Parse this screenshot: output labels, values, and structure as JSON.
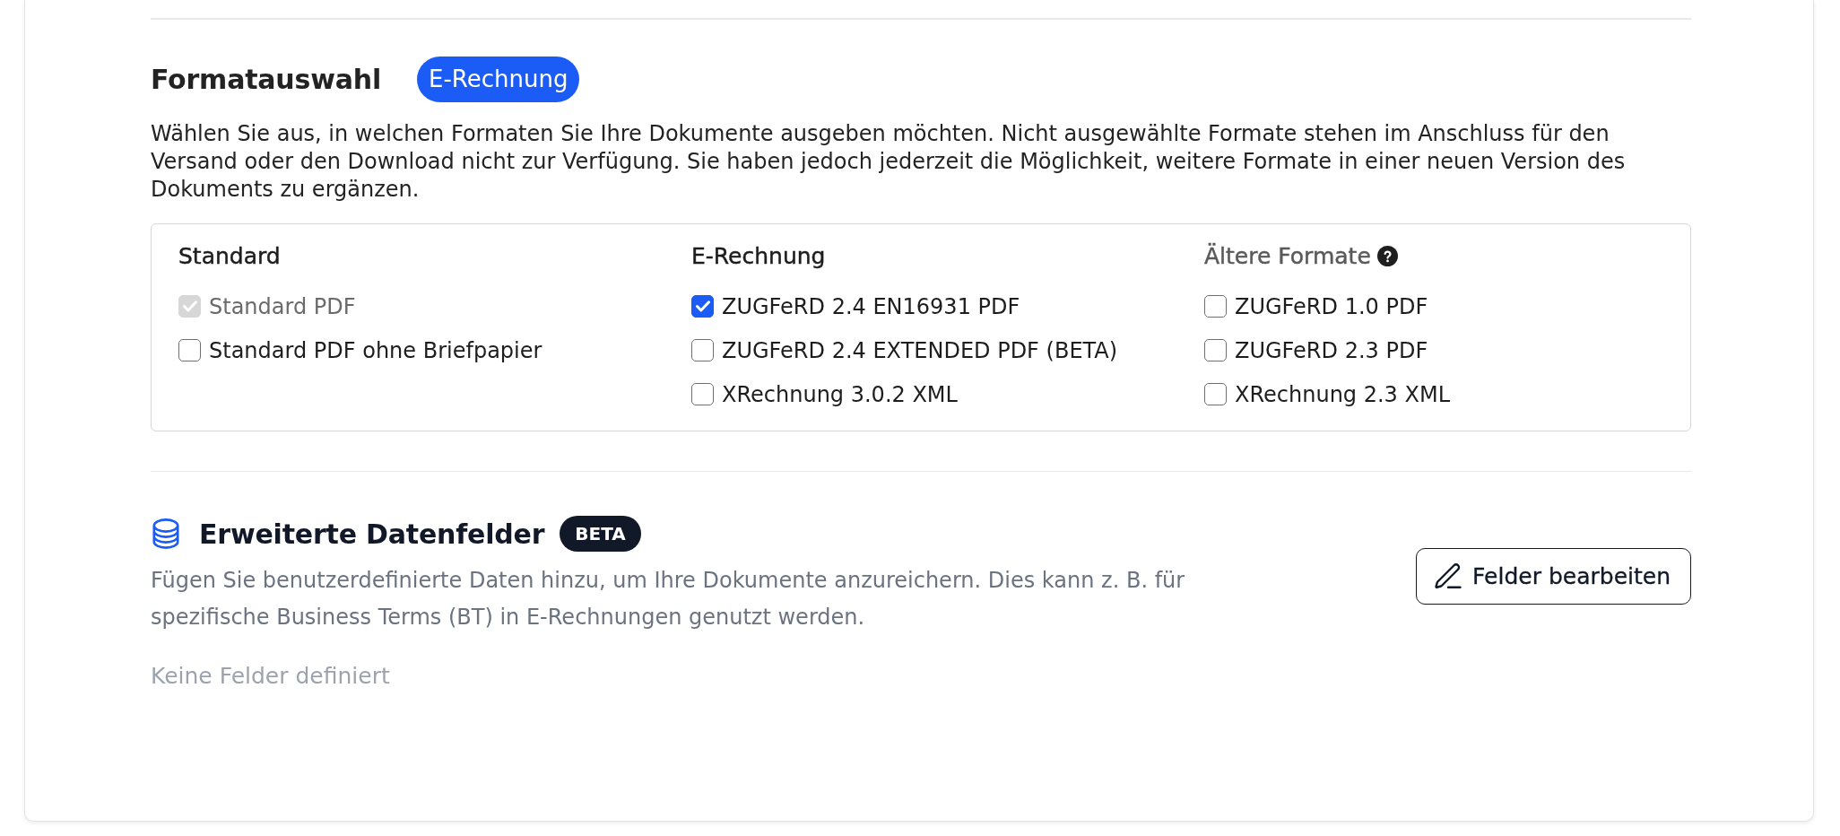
{
  "format_section": {
    "title": "Formatauswahl",
    "badge": "E-Rechnung",
    "description": "Wählen Sie aus, in welchen Formaten Sie Ihre Dokumente ausgeben möchten. Nicht ausgewählte Formate stehen im Anschluss für den Versand oder den Download nicht zur Verfügung. Sie haben jedoch jederzeit die Möglichkeit, weitere Formate in einer neuen Version des Dokuments zu ergänzen.",
    "columns": [
      {
        "heading": "Standard",
        "muted": false,
        "help": false,
        "options": [
          {
            "label": "Standard PDF",
            "checked": true,
            "disabled": true
          },
          {
            "label": "Standard PDF ohne Briefpapier",
            "checked": false,
            "disabled": false
          }
        ]
      },
      {
        "heading": "E-Rechnung",
        "muted": false,
        "help": false,
        "options": [
          {
            "label": "ZUGFeRD 2.4 EN16931 PDF",
            "checked": true,
            "disabled": false
          },
          {
            "label": "ZUGFeRD 2.4 EXTENDED PDF (BETA)",
            "checked": false,
            "disabled": false
          },
          {
            "label": "XRechnung 3.0.2 XML",
            "checked": false,
            "disabled": false
          }
        ]
      },
      {
        "heading": "Ältere Formate",
        "muted": true,
        "help": true,
        "options": [
          {
            "label": "ZUGFeRD 1.0 PDF",
            "checked": false,
            "disabled": false
          },
          {
            "label": "ZUGFeRD 2.3 PDF",
            "checked": false,
            "disabled": false
          },
          {
            "label": "XRechnung 2.3 XML",
            "checked": false,
            "disabled": false
          }
        ]
      }
    ]
  },
  "data_fields_section": {
    "title": "Erweiterte Datenfelder",
    "badge": "BETA",
    "description": "Fügen Sie benutzerdefinierte Daten hinzu, um Ihre Dokumente anzureichern. Dies kann z. B. für spezifische Business Terms (BT) in E-Rechnungen genutzt werden.",
    "button": {
      "label": "Felder bearbeiten"
    },
    "empty_message": "Keine Felder definiert"
  }
}
